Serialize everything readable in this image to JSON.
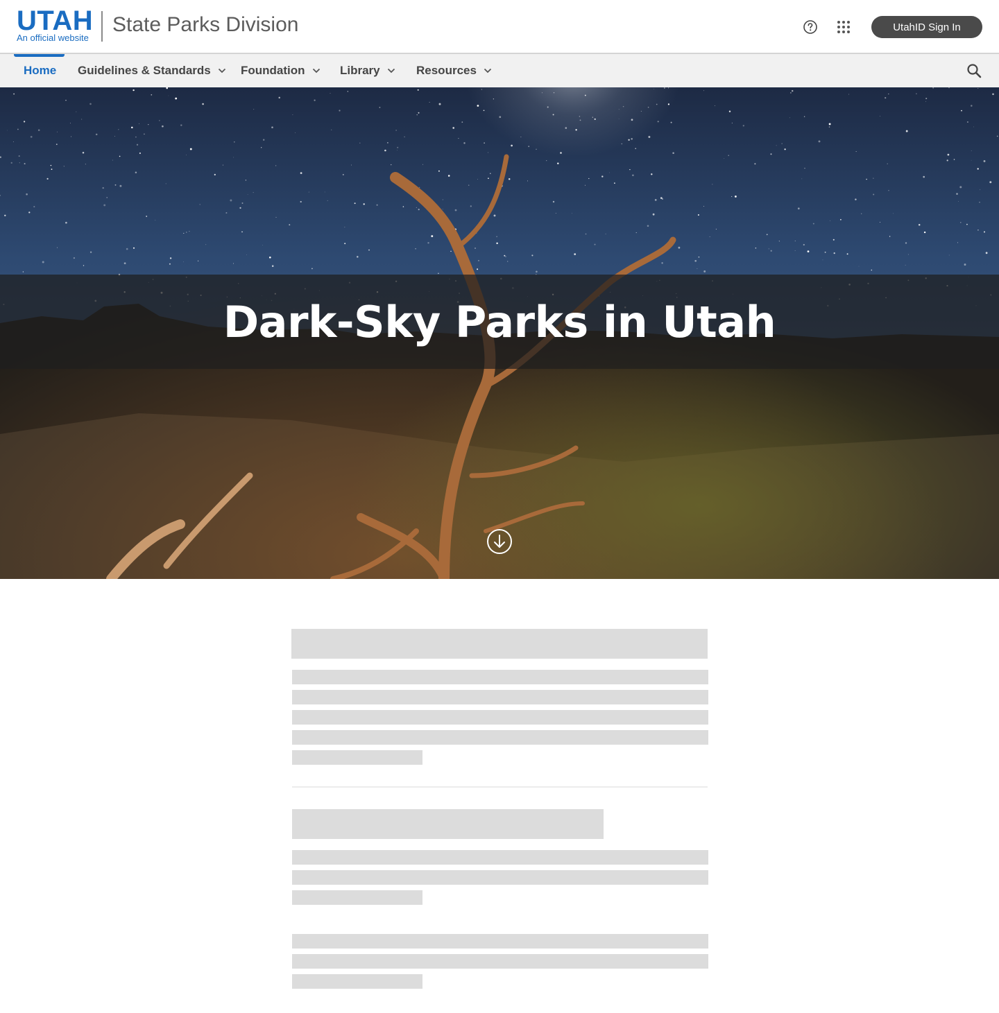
{
  "header": {
    "logo_text": "UTAH",
    "logo_subtext": "An official website",
    "site_title": "State Parks Division",
    "signin_label": "UtahID Sign In"
  },
  "nav": {
    "items": [
      {
        "label": "Home",
        "active": true
      },
      {
        "label": "Guidelines & Standards",
        "has_dropdown": true
      },
      {
        "label": "Foundation",
        "has_dropdown": true
      },
      {
        "label": "Library",
        "has_dropdown": true
      },
      {
        "label": "Resources",
        "has_dropdown": true
      }
    ]
  },
  "hero": {
    "title": "Dark-Sky Parks in Utah"
  },
  "icons": {
    "help": "help-circle-icon",
    "apps": "apps-grid-icon",
    "search": "search-icon",
    "scroll": "arrow-down-circle-icon"
  },
  "colors": {
    "brand_blue": "#1a6cc1",
    "signin_bg": "#4a4a4a",
    "nav_bg": "#f1f1f1",
    "skeleton": "#dcdcdc"
  }
}
